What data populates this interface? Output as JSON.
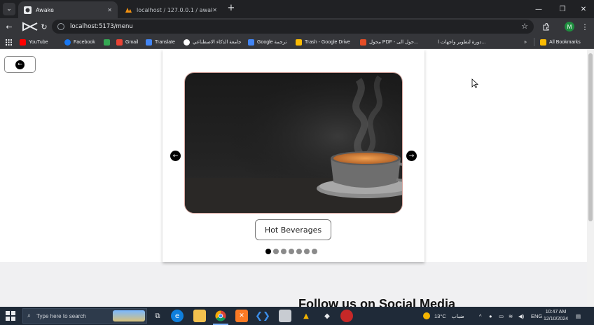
{
  "browser": {
    "tabs": [
      {
        "title": "Awake",
        "active": true
      },
      {
        "title": "localhost / 127.0.0.1 / awake / ",
        "active": false
      }
    ],
    "url": "localhost:5173/menu",
    "profile_initial": "M",
    "bookmarks": [
      {
        "label": "YouTube",
        "icon": "youtube-icon",
        "color": "#ff0000"
      },
      {
        "label": "Facebook",
        "icon": "facebook-icon",
        "color": "#1877f2"
      },
      {
        "label": "",
        "icon": "app-icon",
        "color": "#34a853"
      },
      {
        "label": "Gmail",
        "icon": "gmail-icon",
        "color": "#ea4335"
      },
      {
        "label": "Translate",
        "icon": "translate-icon",
        "color": "#4285f4"
      },
      {
        "label": "جامعة الذكاء الاصطناعي",
        "icon": "university-icon",
        "color": "#ffffff"
      },
      {
        "label": "Google ترجمة",
        "icon": "google-translate-icon",
        "color": "#4285f4"
      },
      {
        "label": "Trash - Google Drive",
        "icon": "drive-icon",
        "color": "#fbbc04"
      },
      {
        "label": "محول PDF - حول الى...",
        "icon": "pdf-icon",
        "color": "#e44d26"
      },
      {
        "label": "دورة لتطوير واجهات ا...",
        "icon": "course-icon",
        "color": "#35363a"
      }
    ],
    "all_bookmarks_label": "All Bookmarks"
  },
  "page": {
    "carousel": {
      "current_category": "Hot Beverages",
      "slide_count": 7,
      "active_index": 0
    },
    "social_heading": "Follow us on Social Media"
  },
  "taskbar": {
    "search_placeholder": "Type here to search",
    "weather": "13°C",
    "weather_desc": "ضباب",
    "language": "ENG",
    "time": "10:47 AM",
    "date": "12/10/2024"
  }
}
